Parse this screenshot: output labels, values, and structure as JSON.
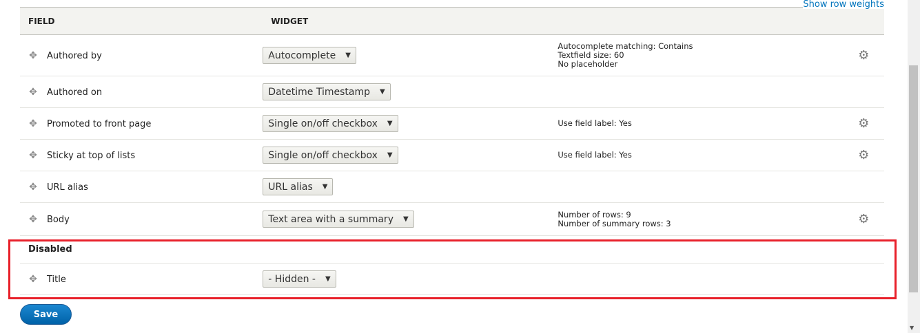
{
  "show_row_weights": "Show row weights",
  "headers": {
    "field": "FIELD",
    "widget": "WIDGET"
  },
  "rows": [
    {
      "label": "Authored by",
      "widget": "Autocomplete",
      "summary": [
        "Autocomplete matching: Contains",
        "Textfield size: 60",
        "No placeholder"
      ],
      "gear": true
    },
    {
      "label": "Authored on",
      "widget": "Datetime Timestamp",
      "summary": [],
      "gear": false
    },
    {
      "label": "Promoted to front page",
      "widget": "Single on/off checkbox",
      "summary": [
        "Use field label: Yes"
      ],
      "gear": true
    },
    {
      "label": "Sticky at top of lists",
      "widget": "Single on/off checkbox",
      "summary": [
        "Use field label: Yes"
      ],
      "gear": true
    },
    {
      "label": "URL alias",
      "widget": "URL alias",
      "summary": [],
      "gear": false
    },
    {
      "label": "Body",
      "widget": "Text area with a summary",
      "summary": [
        "Number of rows: 9",
        "Number of summary rows: 3"
      ],
      "gear": true
    }
  ],
  "disabled": {
    "heading": "Disabled",
    "rows": [
      {
        "label": "Title",
        "widget": "- Hidden -"
      }
    ]
  },
  "save_label": "Save",
  "highlight_color": "#e8202a"
}
